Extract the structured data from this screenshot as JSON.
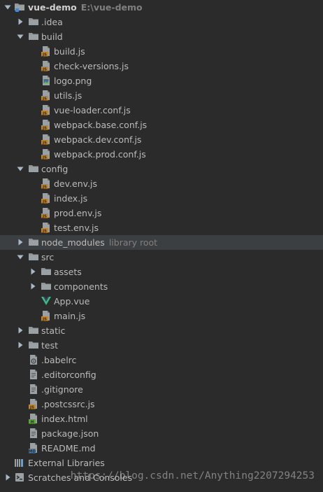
{
  "project": {
    "name": "vue-demo",
    "path": "E:\\vue-demo"
  },
  "items": [
    {
      "label": "vue-demo",
      "hint": "E:\\vue-demo",
      "depth": 0,
      "type": "project-folder",
      "state": "open"
    },
    {
      "label": ".idea",
      "depth": 1,
      "type": "folder",
      "state": "closed"
    },
    {
      "label": "build",
      "depth": 1,
      "type": "folder",
      "state": "open"
    },
    {
      "label": "build.js",
      "depth": 2,
      "type": "js"
    },
    {
      "label": "check-versions.js",
      "depth": 2,
      "type": "js"
    },
    {
      "label": "logo.png",
      "depth": 2,
      "type": "png"
    },
    {
      "label": "utils.js",
      "depth": 2,
      "type": "js"
    },
    {
      "label": "vue-loader.conf.js",
      "depth": 2,
      "type": "js"
    },
    {
      "label": "webpack.base.conf.js",
      "depth": 2,
      "type": "js"
    },
    {
      "label": "webpack.dev.conf.js",
      "depth": 2,
      "type": "js"
    },
    {
      "label": "webpack.prod.conf.js",
      "depth": 2,
      "type": "js"
    },
    {
      "label": "config",
      "depth": 1,
      "type": "folder",
      "state": "open"
    },
    {
      "label": "dev.env.js",
      "depth": 2,
      "type": "js"
    },
    {
      "label": "index.js",
      "depth": 2,
      "type": "js"
    },
    {
      "label": "prod.env.js",
      "depth": 2,
      "type": "js"
    },
    {
      "label": "test.env.js",
      "depth": 2,
      "type": "js"
    },
    {
      "label": "node_modules",
      "hint": "library root",
      "depth": 1,
      "type": "folder",
      "state": "closed",
      "highlight": true
    },
    {
      "label": "src",
      "depth": 1,
      "type": "folder",
      "state": "open"
    },
    {
      "label": "assets",
      "depth": 2,
      "type": "folder",
      "state": "closed"
    },
    {
      "label": "components",
      "depth": 2,
      "type": "folder",
      "state": "closed"
    },
    {
      "label": "App.vue",
      "depth": 2,
      "type": "vue"
    },
    {
      "label": "main.js",
      "depth": 2,
      "type": "js"
    },
    {
      "label": "static",
      "depth": 1,
      "type": "folder",
      "state": "closed"
    },
    {
      "label": "test",
      "depth": 1,
      "type": "folder",
      "state": "closed"
    },
    {
      "label": ".babelrc",
      "depth": 1,
      "type": "config"
    },
    {
      "label": ".editorconfig",
      "depth": 1,
      "type": "text"
    },
    {
      "label": ".gitignore",
      "depth": 1,
      "type": "text"
    },
    {
      "label": ".postcssrc.js",
      "depth": 1,
      "type": "js"
    },
    {
      "label": "index.html",
      "depth": 1,
      "type": "html"
    },
    {
      "label": "package.json",
      "depth": 1,
      "type": "json"
    },
    {
      "label": "README.md",
      "depth": 1,
      "type": "md"
    },
    {
      "label": "External Libraries",
      "depth": 0,
      "type": "libraries"
    },
    {
      "label": "Scratches and Consoles",
      "depth": 0,
      "type": "scratches",
      "state": "closed"
    }
  ],
  "watermark": "https://blog.csdn.net/Anything2207294253",
  "colors": {
    "background": "#2b2b2b",
    "text": "#bbbbbb",
    "hint": "#808080",
    "folder": "#8f9497",
    "js_badge": "#c4862c",
    "vue_green": "#41b883",
    "html_green": "#5aa531",
    "md_blue": "#4a7fb0"
  }
}
